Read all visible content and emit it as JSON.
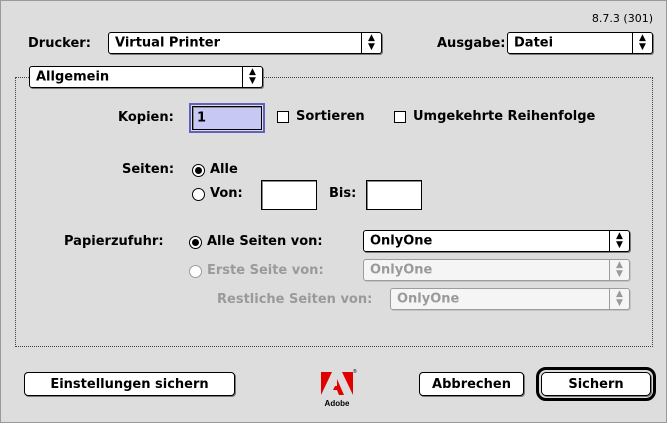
{
  "window": {
    "version": "8.7.3 (301)"
  },
  "printer": {
    "label": "Drucker:",
    "value": "Virtual Printer"
  },
  "output": {
    "label": "Ausgabe:",
    "value": "Datei"
  },
  "panel": {
    "value": "Allgemein"
  },
  "copies": {
    "label": "Kopien:",
    "value": "1",
    "collate_label": "Sortieren",
    "reverse_label": "Umgekehrte Reihenfolge"
  },
  "pages": {
    "label": "Seiten:",
    "all_label": "Alle",
    "from_label": "Von:",
    "to_label": "Bis:",
    "from_value": "",
    "to_value": ""
  },
  "paper": {
    "label": "Papierzufuhr:",
    "all_pages_label": "Alle Seiten von:",
    "all_pages_value": "OnlyOne",
    "first_page_label": "Erste Seite von:",
    "first_page_value": "OnlyOne",
    "remaining_label": "Restliche Seiten von:",
    "remaining_value": "OnlyOne"
  },
  "buttons": {
    "save_settings": "Einstellungen sichern",
    "cancel": "Abbrechen",
    "save": "Sichern"
  },
  "brand": {
    "name": "Adobe"
  },
  "icons": {
    "popup_arrow": "up-down-arrows-icon",
    "logo": "adobe-logo"
  }
}
